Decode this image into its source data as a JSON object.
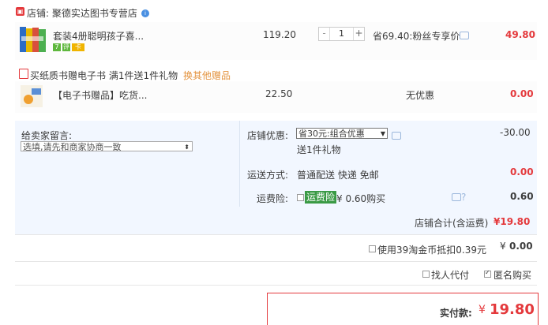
{
  "shop": {
    "label": "店铺: 聚德实达图书专营店",
    "verified_icon": "info-badge-icon"
  },
  "product": {
    "title": "套装4册聪明孩子喜...",
    "price": "119.20",
    "quantity": "1",
    "promo": "省69.40:粉丝专享价",
    "subtotal": "49.80",
    "minus_label": "-",
    "plus_label": "+",
    "badges": [
      {
        "text": "7",
        "color": "#5eb73d"
      },
      {
        "text": "评",
        "color": "#5eb73d"
      },
      {
        "text": "卡",
        "color": "#f0b400"
      }
    ]
  },
  "gift_section": {
    "label": "买纸质书赠电子书   满1件送1件礼物",
    "change_link": "换其他赠品"
  },
  "gift_item": {
    "title": "【电子书赠品】吃货...",
    "price": "22.50",
    "promo": "无优惠",
    "subtotal": "0.00"
  },
  "message": {
    "label": "给卖家留言:",
    "placeholder": "选填,请先和商家协商一致"
  },
  "discount": {
    "label": "店铺优惠:",
    "selected": "省30元:组合优惠",
    "gift_note": "送1件礼物",
    "amount": "-30.00"
  },
  "shipping": {
    "label": "运送方式:",
    "method": "普通配送 快递 免邮",
    "amount": "0.00"
  },
  "insurance": {
    "label": "运费险:",
    "tag": "运费险",
    "price_text": "¥ 0.60购买",
    "amount": "0.60"
  },
  "shop_total": {
    "label": "店铺合计(含运费)",
    "amount": "¥19.80"
  },
  "coins": {
    "label": "使用39淘金币抵扣0.39元",
    "currency": "¥",
    "amount": "0.00"
  },
  "options": {
    "proxy_pay": "找人代付",
    "anonymous": "匿名购买"
  },
  "final": {
    "label": "实付款:",
    "currency": "¥",
    "amount": "19.80"
  },
  "colors": {
    "accent_red": "#e4393c",
    "link_orange": "#e3933e",
    "panel_blue": "#f2f7ff",
    "insurance_green": "#3a9a45"
  }
}
